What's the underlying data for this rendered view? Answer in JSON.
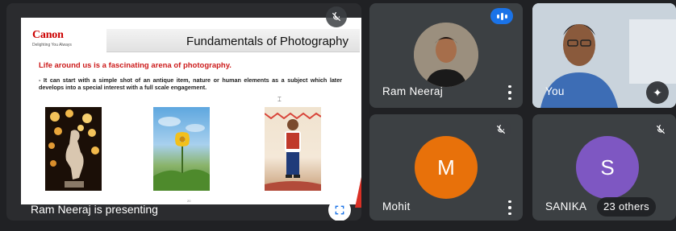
{
  "presentation": {
    "slide": {
      "logo_text": "Canon",
      "logo_tagline": "Delighting You Always",
      "title": "Fundamentals of Photography",
      "subtitle": "Life around us is a fascinating arena of photography.",
      "body": "- It can start with a simple shot of an antique item, nature or human elements as a subject which later develops into a special interest with a full scale engagement.",
      "page_number": "20"
    },
    "presenter_label": "Ram Neeraj is presenting"
  },
  "participants": [
    {
      "name": "Ram Neeraj",
      "status": "speaking"
    },
    {
      "name": "You"
    },
    {
      "name": "Mohit",
      "initial": "M",
      "avatar_color": "#e8710a",
      "status": "muted"
    },
    {
      "name": "SANIKA",
      "initial": "S",
      "avatar_color": "#7e57c2",
      "status": "muted"
    }
  ],
  "others_label": "23 others",
  "colors": {
    "background": "#202124",
    "tile": "#3c4043",
    "accent": "#1a73e8",
    "slide_red": "#cc1a1a"
  },
  "icons": [
    "mic-off-icon",
    "fullscreen-icon",
    "more-vert-icon",
    "speaking-indicator-icon",
    "visual-effects-icon"
  ]
}
